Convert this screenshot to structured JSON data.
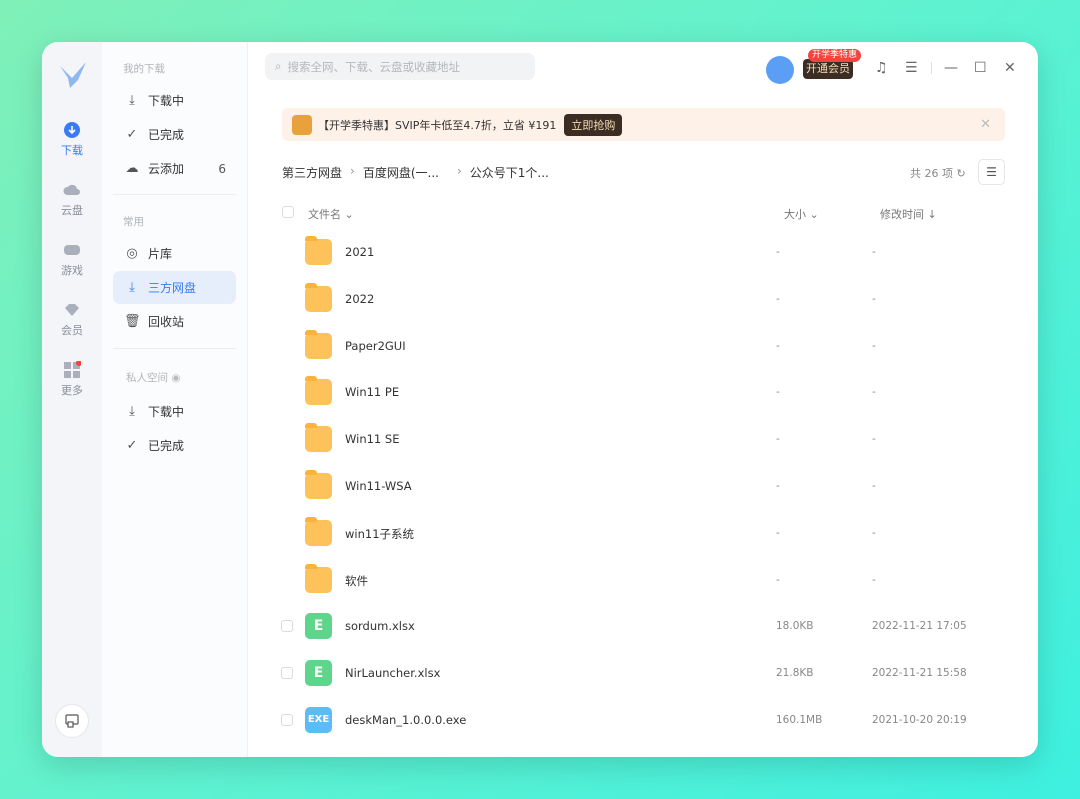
{
  "rail": {
    "items": [
      {
        "label": "下载",
        "icon": "download-icon",
        "active": true
      },
      {
        "label": "云盘",
        "icon": "cloud-icon"
      },
      {
        "label": "游戏",
        "icon": "gamepad-icon"
      },
      {
        "label": "会员",
        "icon": "diamond-icon"
      },
      {
        "label": "更多",
        "icon": "grid-icon"
      }
    ]
  },
  "nav": {
    "sec_mine": "我的下载",
    "sec_common": "常用",
    "sec_private": "私人空间",
    "mine": [
      {
        "label": "下载中",
        "icon": "download-icon"
      },
      {
        "label": "已完成",
        "icon": "check-circle-icon"
      },
      {
        "label": "云添加",
        "icon": "cloud-upload-icon",
        "count": "6"
      }
    ],
    "common": [
      {
        "label": "片库",
        "icon": "film-reel-icon"
      },
      {
        "label": "三方网盘",
        "icon": "netdisk-icon",
        "active": true
      },
      {
        "label": "回收站",
        "icon": "trash-icon"
      }
    ],
    "private": [
      {
        "label": "下载中",
        "icon": "download-lock-icon"
      },
      {
        "label": "已完成",
        "icon": "check-lock-icon"
      }
    ]
  },
  "header": {
    "search_placeholder": "搜索全网、下载、云盘或收藏地址",
    "vip_label": "开通会员",
    "vip_badge": "开学季特惠"
  },
  "banner": {
    "text": "【开学季特惠】SVIP年卡低至4.7折，立省 ¥191",
    "button": "立即抢购"
  },
  "breadcrumb": [
    "第三方网盘",
    "百度网盘(一...",
    "公众号下1个..."
  ],
  "count": "共 26 项",
  "columns": {
    "name": "文件名",
    "size": "大小",
    "time": "修改时间"
  },
  "files": [
    {
      "name": "2021",
      "type": "folder",
      "size": "-",
      "time": "-"
    },
    {
      "name": "2022",
      "type": "folder",
      "size": "-",
      "time": "-"
    },
    {
      "name": "Paper2GUI",
      "type": "folder",
      "size": "-",
      "time": "-"
    },
    {
      "name": "Win11 PE",
      "type": "folder",
      "size": "-",
      "time": "-"
    },
    {
      "name": "Win11 SE",
      "type": "folder",
      "size": "-",
      "time": "-"
    },
    {
      "name": "Win11-WSA",
      "type": "folder",
      "size": "-",
      "time": "-"
    },
    {
      "name": "win11子系统",
      "type": "folder",
      "size": "-",
      "time": "-"
    },
    {
      "name": "软件",
      "type": "folder",
      "size": "-",
      "time": "-"
    },
    {
      "name": "sordum.xlsx",
      "type": "xlsx",
      "size": "18.0KB",
      "time": "2022-11-21 17:05"
    },
    {
      "name": "NirLauncher.xlsx",
      "type": "xlsx",
      "size": "21.8KB",
      "time": "2022-11-21 15:58"
    },
    {
      "name": "deskMan_1.0.0.0.exe",
      "type": "exe",
      "size": "160.1MB",
      "time": "2021-10-20 20:19"
    }
  ],
  "icon_text": {
    "xlsx": "E",
    "exe": "EXE"
  },
  "colors": {
    "accent": "#3a7bf5",
    "vip": "#3b2d23"
  }
}
